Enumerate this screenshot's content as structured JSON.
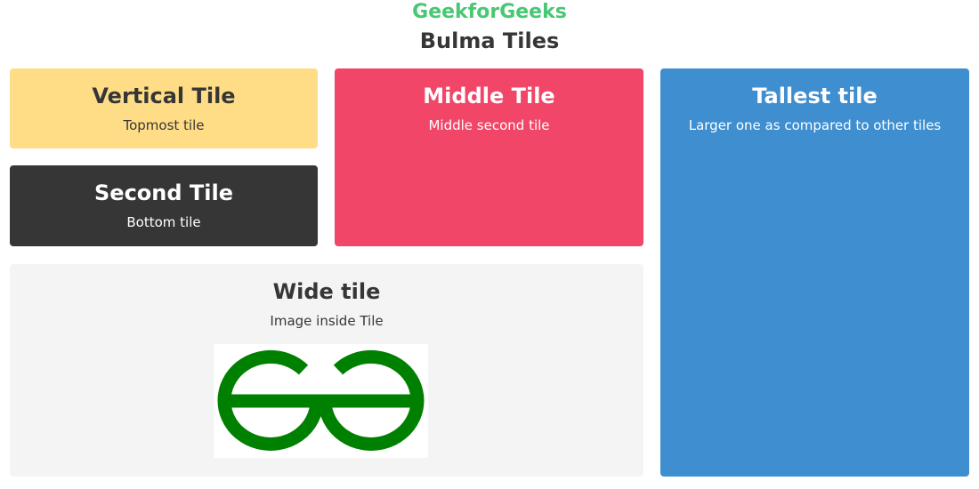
{
  "header": {
    "site_name": "GeekforGeeks",
    "page_title": "Bulma Tiles"
  },
  "colors": {
    "brand_green": "#48c774",
    "warning_yellow": "#ffdd87",
    "dark": "#363636",
    "danger_red": "#f14668",
    "info_blue": "#3e8ed0",
    "light_gray": "#f4f4f4",
    "logo_green": "#008000"
  },
  "tiles": {
    "vertical": {
      "title": "Vertical Tile",
      "subtitle": "Topmost tile"
    },
    "second": {
      "title": "Second Tile",
      "subtitle": "Bottom tile"
    },
    "middle": {
      "title": "Middle Tile",
      "subtitle": "Middle second tile"
    },
    "tallest": {
      "title": "Tallest tile",
      "subtitle": "Larger one as compared to other tiles"
    },
    "wide": {
      "title": "Wide tile",
      "subtitle": "Image inside Tile",
      "image_icon": "geeksforgeeks-logo-icon"
    }
  }
}
